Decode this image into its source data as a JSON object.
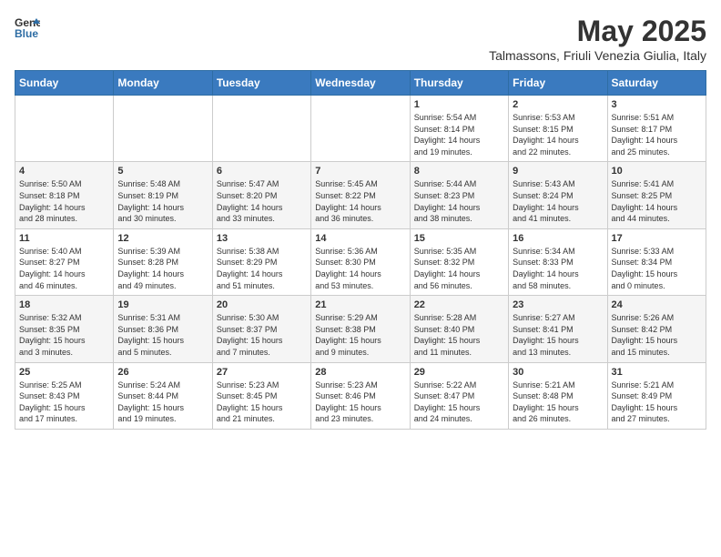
{
  "header": {
    "logo_general": "General",
    "logo_blue": "Blue",
    "month_title": "May 2025",
    "location": "Talmassons, Friuli Venezia Giulia, Italy"
  },
  "weekdays": [
    "Sunday",
    "Monday",
    "Tuesday",
    "Wednesday",
    "Thursday",
    "Friday",
    "Saturday"
  ],
  "weeks": [
    [
      {
        "day": "",
        "detail": ""
      },
      {
        "day": "",
        "detail": ""
      },
      {
        "day": "",
        "detail": ""
      },
      {
        "day": "",
        "detail": ""
      },
      {
        "day": "1",
        "detail": "Sunrise: 5:54 AM\nSunset: 8:14 PM\nDaylight: 14 hours\nand 19 minutes."
      },
      {
        "day": "2",
        "detail": "Sunrise: 5:53 AM\nSunset: 8:15 PM\nDaylight: 14 hours\nand 22 minutes."
      },
      {
        "day": "3",
        "detail": "Sunrise: 5:51 AM\nSunset: 8:17 PM\nDaylight: 14 hours\nand 25 minutes."
      }
    ],
    [
      {
        "day": "4",
        "detail": "Sunrise: 5:50 AM\nSunset: 8:18 PM\nDaylight: 14 hours\nand 28 minutes."
      },
      {
        "day": "5",
        "detail": "Sunrise: 5:48 AM\nSunset: 8:19 PM\nDaylight: 14 hours\nand 30 minutes."
      },
      {
        "day": "6",
        "detail": "Sunrise: 5:47 AM\nSunset: 8:20 PM\nDaylight: 14 hours\nand 33 minutes."
      },
      {
        "day": "7",
        "detail": "Sunrise: 5:45 AM\nSunset: 8:22 PM\nDaylight: 14 hours\nand 36 minutes."
      },
      {
        "day": "8",
        "detail": "Sunrise: 5:44 AM\nSunset: 8:23 PM\nDaylight: 14 hours\nand 38 minutes."
      },
      {
        "day": "9",
        "detail": "Sunrise: 5:43 AM\nSunset: 8:24 PM\nDaylight: 14 hours\nand 41 minutes."
      },
      {
        "day": "10",
        "detail": "Sunrise: 5:41 AM\nSunset: 8:25 PM\nDaylight: 14 hours\nand 44 minutes."
      }
    ],
    [
      {
        "day": "11",
        "detail": "Sunrise: 5:40 AM\nSunset: 8:27 PM\nDaylight: 14 hours\nand 46 minutes."
      },
      {
        "day": "12",
        "detail": "Sunrise: 5:39 AM\nSunset: 8:28 PM\nDaylight: 14 hours\nand 49 minutes."
      },
      {
        "day": "13",
        "detail": "Sunrise: 5:38 AM\nSunset: 8:29 PM\nDaylight: 14 hours\nand 51 minutes."
      },
      {
        "day": "14",
        "detail": "Sunrise: 5:36 AM\nSunset: 8:30 PM\nDaylight: 14 hours\nand 53 minutes."
      },
      {
        "day": "15",
        "detail": "Sunrise: 5:35 AM\nSunset: 8:32 PM\nDaylight: 14 hours\nand 56 minutes."
      },
      {
        "day": "16",
        "detail": "Sunrise: 5:34 AM\nSunset: 8:33 PM\nDaylight: 14 hours\nand 58 minutes."
      },
      {
        "day": "17",
        "detail": "Sunrise: 5:33 AM\nSunset: 8:34 PM\nDaylight: 15 hours\nand 0 minutes."
      }
    ],
    [
      {
        "day": "18",
        "detail": "Sunrise: 5:32 AM\nSunset: 8:35 PM\nDaylight: 15 hours\nand 3 minutes."
      },
      {
        "day": "19",
        "detail": "Sunrise: 5:31 AM\nSunset: 8:36 PM\nDaylight: 15 hours\nand 5 minutes."
      },
      {
        "day": "20",
        "detail": "Sunrise: 5:30 AM\nSunset: 8:37 PM\nDaylight: 15 hours\nand 7 minutes."
      },
      {
        "day": "21",
        "detail": "Sunrise: 5:29 AM\nSunset: 8:38 PM\nDaylight: 15 hours\nand 9 minutes."
      },
      {
        "day": "22",
        "detail": "Sunrise: 5:28 AM\nSunset: 8:40 PM\nDaylight: 15 hours\nand 11 minutes."
      },
      {
        "day": "23",
        "detail": "Sunrise: 5:27 AM\nSunset: 8:41 PM\nDaylight: 15 hours\nand 13 minutes."
      },
      {
        "day": "24",
        "detail": "Sunrise: 5:26 AM\nSunset: 8:42 PM\nDaylight: 15 hours\nand 15 minutes."
      }
    ],
    [
      {
        "day": "25",
        "detail": "Sunrise: 5:25 AM\nSunset: 8:43 PM\nDaylight: 15 hours\nand 17 minutes."
      },
      {
        "day": "26",
        "detail": "Sunrise: 5:24 AM\nSunset: 8:44 PM\nDaylight: 15 hours\nand 19 minutes."
      },
      {
        "day": "27",
        "detail": "Sunrise: 5:23 AM\nSunset: 8:45 PM\nDaylight: 15 hours\nand 21 minutes."
      },
      {
        "day": "28",
        "detail": "Sunrise: 5:23 AM\nSunset: 8:46 PM\nDaylight: 15 hours\nand 23 minutes."
      },
      {
        "day": "29",
        "detail": "Sunrise: 5:22 AM\nSunset: 8:47 PM\nDaylight: 15 hours\nand 24 minutes."
      },
      {
        "day": "30",
        "detail": "Sunrise: 5:21 AM\nSunset: 8:48 PM\nDaylight: 15 hours\nand 26 minutes."
      },
      {
        "day": "31",
        "detail": "Sunrise: 5:21 AM\nSunset: 8:49 PM\nDaylight: 15 hours\nand 27 minutes."
      }
    ]
  ]
}
